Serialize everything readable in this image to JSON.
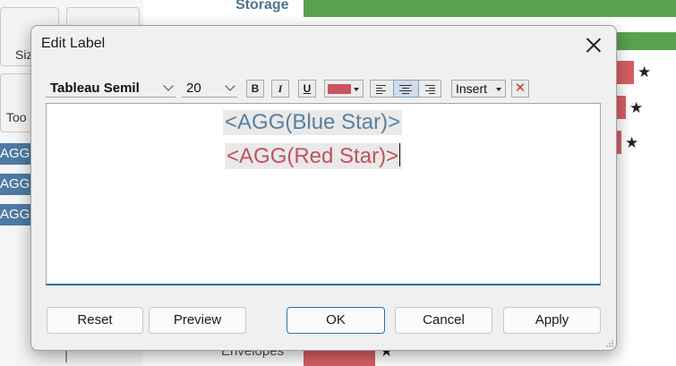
{
  "background": {
    "left_cards": [
      {
        "label": "Siz"
      },
      {
        "label": "Too"
      }
    ],
    "pills": [
      "AGG(M",
      "AGG(E",
      "AGG(R"
    ],
    "storage_label": "Storage",
    "envelopes_label": "Envelopes",
    "star_glyph": "★"
  },
  "dialog": {
    "title": "Edit Label",
    "toolbar": {
      "font_family": "Tableau Semil",
      "font_size": "20",
      "bold_label": "B",
      "italic_label": "I",
      "underline_label": "U",
      "text_color": "#c8545e",
      "insert_label": "Insert",
      "clear_label": "✕"
    },
    "editor": {
      "line1": "<AGG(Blue Star)>",
      "line2": "<AGG(Red Star)>",
      "line1_color": "#5a7fa0",
      "line2_color": "#c2515b"
    },
    "buttons": {
      "reset": "Reset",
      "preview": "Preview",
      "ok": "OK",
      "cancel": "Cancel",
      "apply": "Apply"
    }
  }
}
